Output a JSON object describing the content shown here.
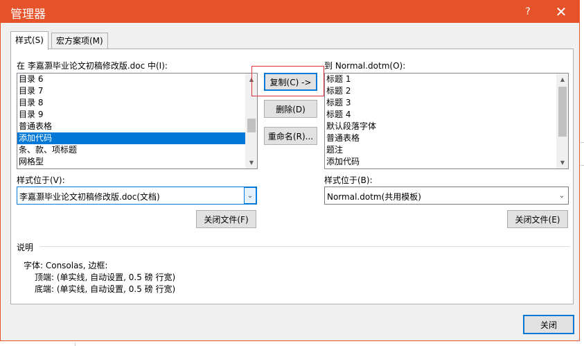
{
  "window": {
    "title": "管理器",
    "help_label": "?",
    "close_label": "✕"
  },
  "tabs": [
    {
      "label": "样式(S)",
      "active": true
    },
    {
      "label": "宏方案项(M)",
      "active": false
    }
  ],
  "left": {
    "label": "在 李嘉灏毕业论文初稿修改版.doc 中(I):",
    "items": [
      "目录 6",
      "目录 7",
      "目录 8",
      "目录 9",
      "普通表格",
      "添加代码",
      "条、款、项标题",
      "网格型"
    ],
    "selected_index": 5,
    "styles_in_label": "样式位于(V):",
    "styles_in_value": "李嘉灏毕业论文初稿修改版.doc(文档)",
    "close_file_label": "关闭文件(F)"
  },
  "right": {
    "label": "到 Normal.dotm(O):",
    "items": [
      "标题 1",
      "标题 2",
      "标题 3",
      "标题 4",
      "默认段落字体",
      "普通表格",
      "题注",
      "添加代码"
    ],
    "styles_in_label": "样式位于(B):",
    "styles_in_value": "Normal.dotm(共用模板)",
    "close_file_label": "关闭文件(E)"
  },
  "middle": {
    "copy_label": "复制(C) ->",
    "delete_label": "删除(D)",
    "rename_label": "重命名(R)..."
  },
  "description": {
    "header": "说明",
    "line1": "字体: Consolas, 边框:",
    "line2": "顶端: (单实线, 自动设置, 0.5 磅 行宽)",
    "line3": "底端: (单实线, 自动设置, 0.5 磅 行宽)"
  },
  "footer": {
    "close_label": "关闭"
  },
  "icons": {
    "scroll_up": "▲",
    "scroll_down": "▼",
    "dropdown": "⌄"
  },
  "colors": {
    "titlebar": "#e6532a",
    "selection": "#0078d7",
    "highlight_box": "#e0303a"
  }
}
